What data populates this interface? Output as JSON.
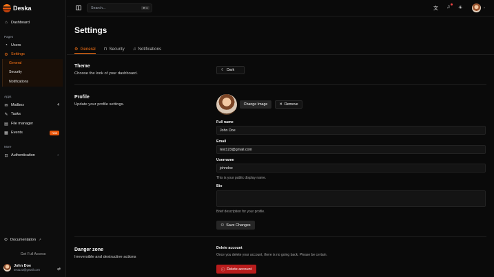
{
  "brand": {
    "name": "Deska"
  },
  "sidebar": {
    "dashboard": "Dashboard",
    "pages_label": "Pages",
    "users": "Users",
    "settings": "Settings",
    "settings_sub": [
      "General",
      "Security",
      "Notifications"
    ],
    "apps_label": "Apps",
    "mailbox": "Mailbox",
    "mailbox_count": "4",
    "tasks": "Tasks",
    "file_manager": "File manager",
    "events": "Events",
    "events_badge": "new",
    "more_label": "More",
    "authentication": "Authentication",
    "documentation": "Documentation",
    "get_full_access": "Get Full Access",
    "user_name": "John Doe",
    "user_email": "test123@gmail.com"
  },
  "topbar": {
    "search_placeholder": "Search...",
    "search_shortcut": "⌘ K"
  },
  "page": {
    "title": "Settings",
    "tabs": [
      "General",
      "Security",
      "Notifications"
    ]
  },
  "theme": {
    "title": "Theme",
    "desc": "Choose the look of your dashboard.",
    "value": "Dark"
  },
  "profile": {
    "title": "Profile",
    "desc": "Update your profile settings.",
    "change_image": "Change Image",
    "remove": "Remove",
    "full_name_label": "Full name",
    "full_name": "John Doe",
    "email_label": "Email",
    "email": "test123@gmail.com",
    "username_label": "Username",
    "username": "johndoe",
    "username_hint": "This is your public display name.",
    "bio_label": "Bio",
    "bio_hint": "Brief description for your profile.",
    "save": "Save Changes"
  },
  "danger": {
    "title": "Danger zone",
    "desc": "Irreversible and destructive actions",
    "delete_title": "Delete account",
    "delete_desc": "Once you delete your account, there is no going back. Please be certain.",
    "delete_button": "Delete account"
  },
  "colors": {
    "accent": "#f97316",
    "danger": "#b91c1c",
    "background": "#0a0a0a"
  }
}
